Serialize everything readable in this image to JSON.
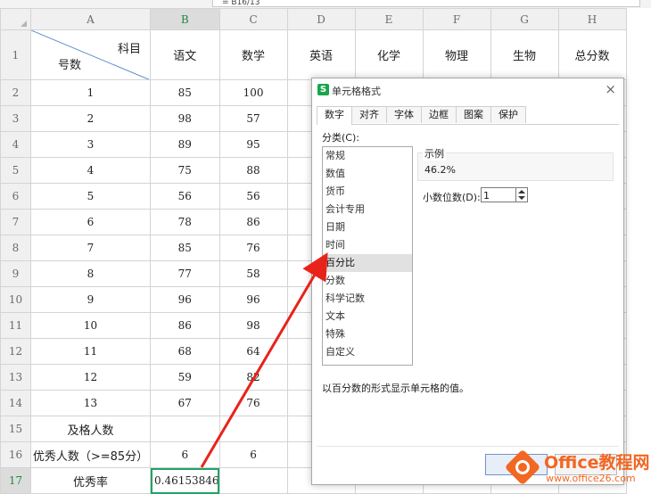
{
  "formula_bar": {
    "value": "= B16/13"
  },
  "sheet": {
    "columns": [
      "A",
      "B",
      "C",
      "D",
      "E",
      "F",
      "G",
      "H"
    ],
    "header_row": {
      "a_top": "科目",
      "a_bottom": "号数",
      "b": "语文",
      "c": "数学",
      "d": "英语",
      "e": "化学",
      "f": "物理",
      "g": "生物",
      "h": "总分数"
    },
    "rows": [
      {
        "num": "2",
        "a": "1",
        "b": "85",
        "c": "100"
      },
      {
        "num": "3",
        "a": "2",
        "b": "98",
        "c": "57"
      },
      {
        "num": "4",
        "a": "3",
        "b": "89",
        "c": "95"
      },
      {
        "num": "5",
        "a": "4",
        "b": "75",
        "c": "88"
      },
      {
        "num": "6",
        "a": "5",
        "b": "56",
        "c": "56"
      },
      {
        "num": "7",
        "a": "6",
        "b": "78",
        "c": "86"
      },
      {
        "num": "8",
        "a": "7",
        "b": "85",
        "c": "76"
      },
      {
        "num": "9",
        "a": "8",
        "b": "77",
        "c": "58"
      },
      {
        "num": "10",
        "a": "9",
        "b": "96",
        "c": "96"
      },
      {
        "num": "11",
        "a": "10",
        "b": "86",
        "c": "98"
      },
      {
        "num": "12",
        "a": "11",
        "b": "68",
        "c": "64"
      },
      {
        "num": "13",
        "a": "12",
        "b": "59",
        "c": "82"
      },
      {
        "num": "14",
        "a": "13",
        "b": "67",
        "c": "76"
      }
    ],
    "row1_num": "1",
    "row15": {
      "num": "15",
      "a": "及格人数",
      "b": "",
      "c": ""
    },
    "row16": {
      "num": "16",
      "a": "优秀人数（>=85分）",
      "b": "6",
      "c": "6"
    },
    "row17": {
      "num": "17",
      "a": "优秀率",
      "b": "0.46153846",
      "c": ""
    }
  },
  "dialog": {
    "title": "单元格格式",
    "close": "×",
    "tabs": [
      "数字",
      "对齐",
      "字体",
      "边框",
      "图案",
      "保护"
    ],
    "category_label": "分类(C):",
    "categories": [
      "常规",
      "数值",
      "货币",
      "会计专用",
      "日期",
      "时间",
      "百分比",
      "分数",
      "科学记数",
      "文本",
      "特殊",
      "自定义"
    ],
    "selected_category": "百分比",
    "sample_label": "示例",
    "sample_value": "46.2%",
    "decimal_label": "小数位数(D):",
    "decimal_value": "1",
    "description": "以百分数的形式显示单元格的值。",
    "ok_label": "",
    "cancel_label": ""
  },
  "watermark": {
    "brand": "Office教程网",
    "url": "www.office26.com"
  },
  "colors": {
    "accent": "#21a366",
    "arrow": "#e8231a",
    "watermark": "#f26722"
  }
}
